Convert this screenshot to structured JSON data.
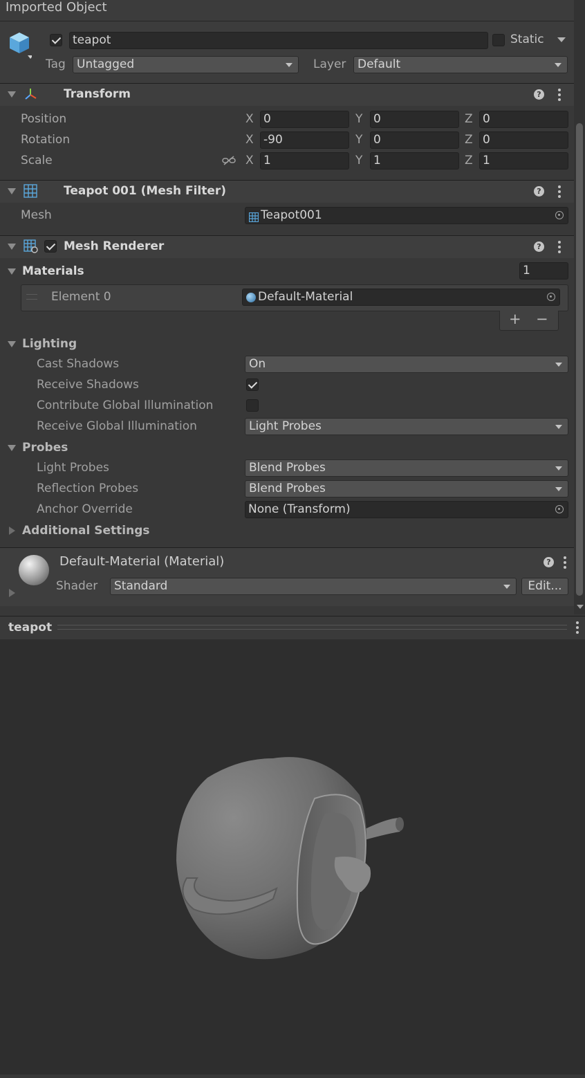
{
  "window": {
    "title": "Imported Object"
  },
  "object": {
    "name": "teapot",
    "active": true,
    "static_label": "Static",
    "static": false,
    "tag_label": "Tag",
    "tag_value": "Untagged",
    "layer_label": "Layer",
    "layer_value": "Default"
  },
  "transform": {
    "title": "Transform",
    "position": {
      "label": "Position",
      "x": "0",
      "y": "0",
      "z": "0"
    },
    "rotation": {
      "label": "Rotation",
      "x": "-90",
      "y": "0",
      "z": "0"
    },
    "scale": {
      "label": "Scale",
      "x": "1",
      "y": "1",
      "z": "1"
    },
    "axes": {
      "x": "X",
      "y": "Y",
      "z": "Z"
    }
  },
  "mesh_filter": {
    "title": "Teapot 001 (Mesh Filter)",
    "mesh_label": "Mesh",
    "mesh_value": "Teapot001"
  },
  "mesh_renderer": {
    "title": "Mesh Renderer",
    "enabled": true,
    "materials_label": "Materials",
    "materials_count": "1",
    "element_label": "Element 0",
    "element_value": "Default-Material",
    "add_symbol": "+",
    "remove_symbol": "−",
    "lighting_label": "Lighting",
    "cast_shadows_label": "Cast Shadows",
    "cast_shadows_value": "On",
    "receive_shadows_label": "Receive Shadows",
    "receive_shadows": true,
    "contribute_gi_label": "Contribute Global Illumination",
    "contribute_gi": false,
    "receive_gi_label": "Receive Global Illumination",
    "receive_gi_value": "Light Probes",
    "probes_label": "Probes",
    "light_probes_label": "Light Probes",
    "light_probes_value": "Blend Probes",
    "reflection_probes_label": "Reflection Probes",
    "reflection_probes_value": "Blend Probes",
    "anchor_override_label": "Anchor Override",
    "anchor_override_value": "None (Transform)",
    "additional_settings_label": "Additional Settings"
  },
  "material": {
    "title": "Default-Material (Material)",
    "shader_label": "Shader",
    "shader_value": "Standard",
    "edit_label": "Edit..."
  },
  "preview": {
    "title": "teapot"
  },
  "icons": {
    "help": "?",
    "colors": {
      "accent_blue": "#5aa7dc",
      "panel": "#383838",
      "field": "#2a2a2a",
      "header": "#3e3e3e"
    }
  }
}
